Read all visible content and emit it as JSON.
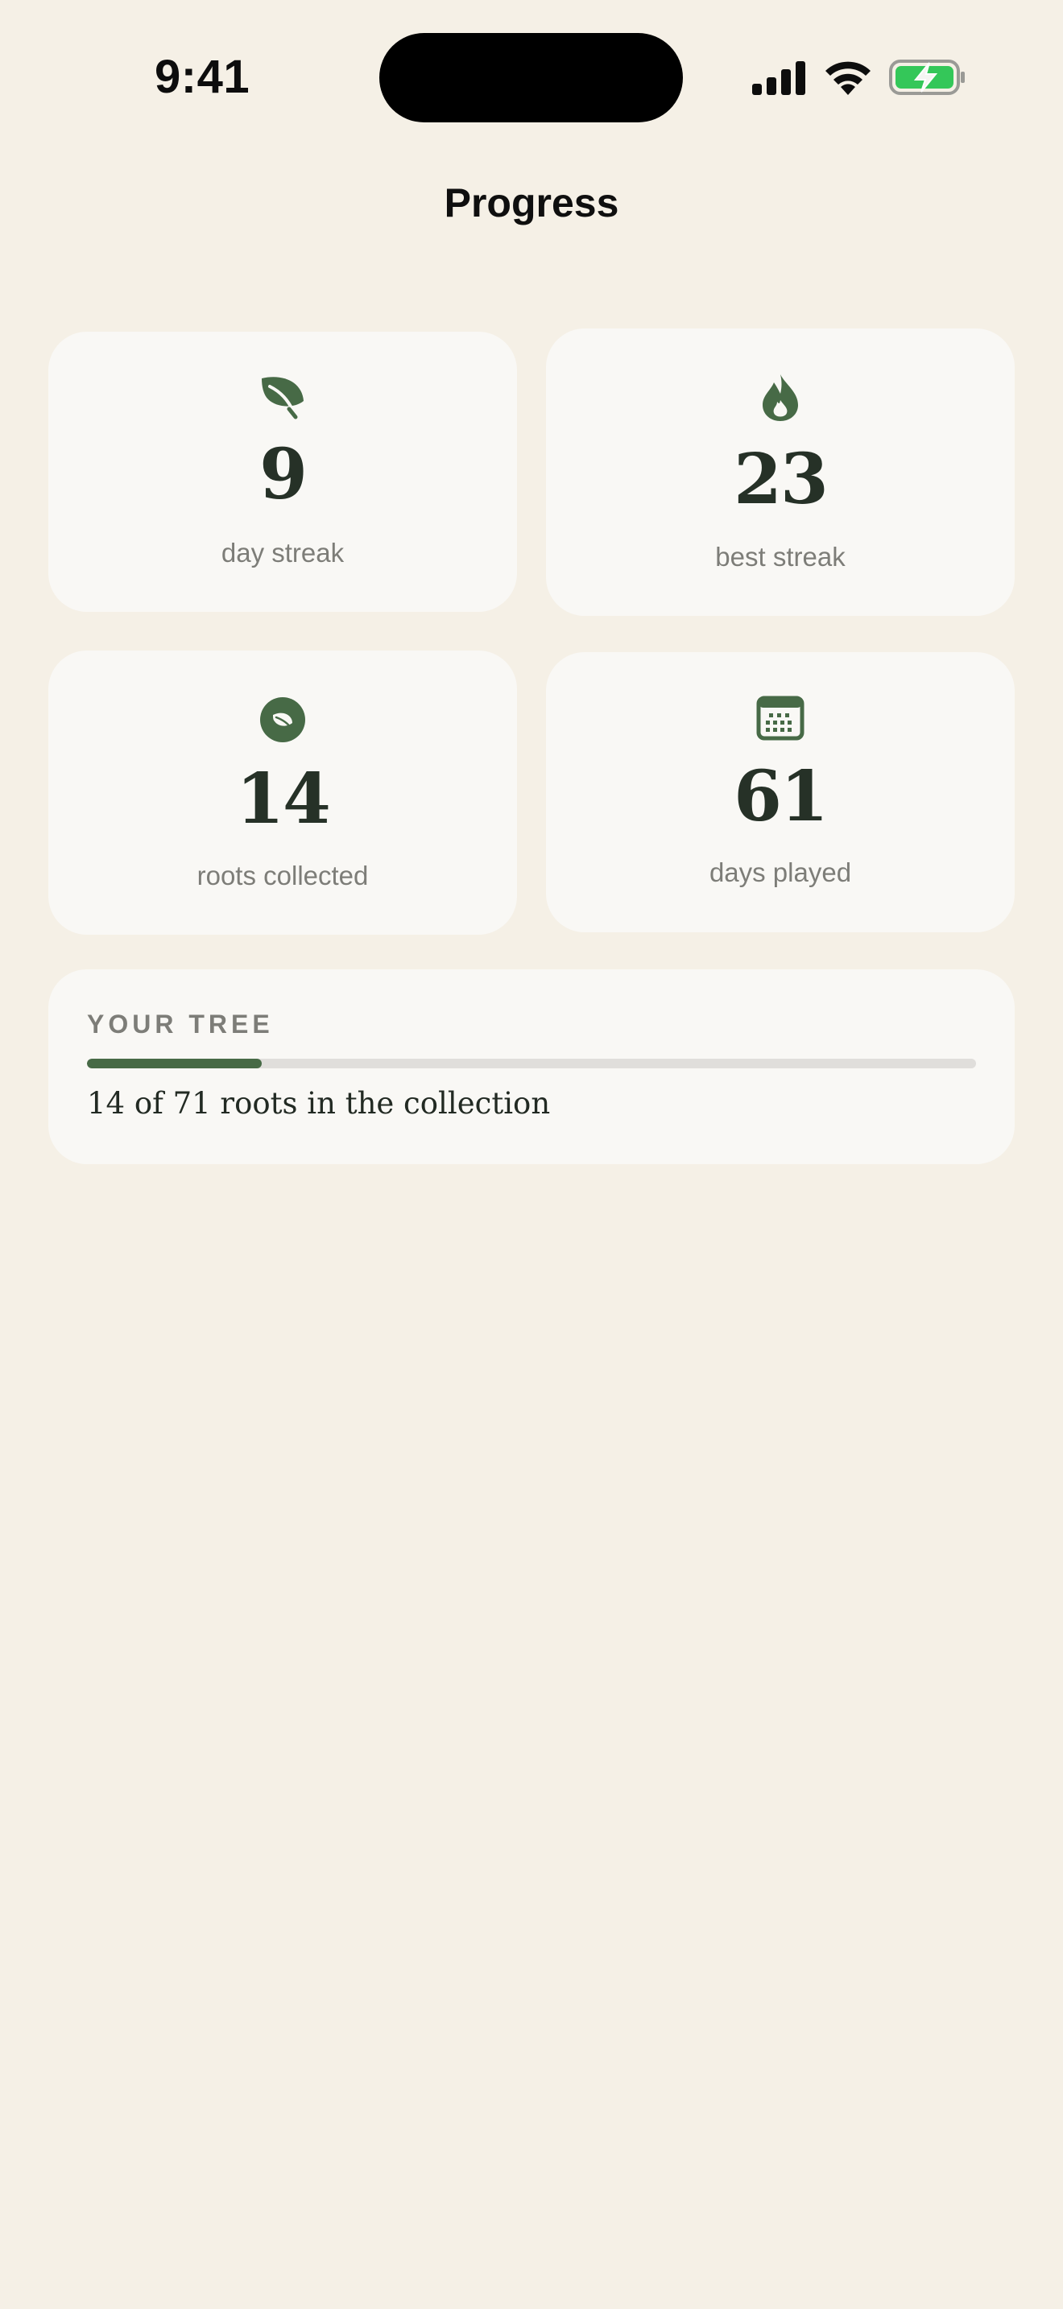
{
  "status_bar": {
    "time": "9:41"
  },
  "header": {
    "title": "Progress"
  },
  "stats": [
    {
      "value": "9",
      "label": "day streak",
      "icon": "leaf-icon"
    },
    {
      "value": "23",
      "label": "best streak",
      "icon": "flame-icon"
    },
    {
      "value": "14",
      "label": "roots collected",
      "icon": "leaf-badge-icon"
    },
    {
      "value": "61",
      "label": "days played",
      "icon": "calendar-icon"
    }
  ],
  "tree": {
    "heading": "YOUR TREE",
    "caption": "14 of 71 roots in the collection",
    "progress_fraction": 0.197
  },
  "colors": {
    "background": "#f5f0e6",
    "card": "#f9f8f5",
    "accent_green": "#476a46",
    "battery_green": "#34c759",
    "value_text": "#263127",
    "muted_text": "#7d7d78"
  }
}
